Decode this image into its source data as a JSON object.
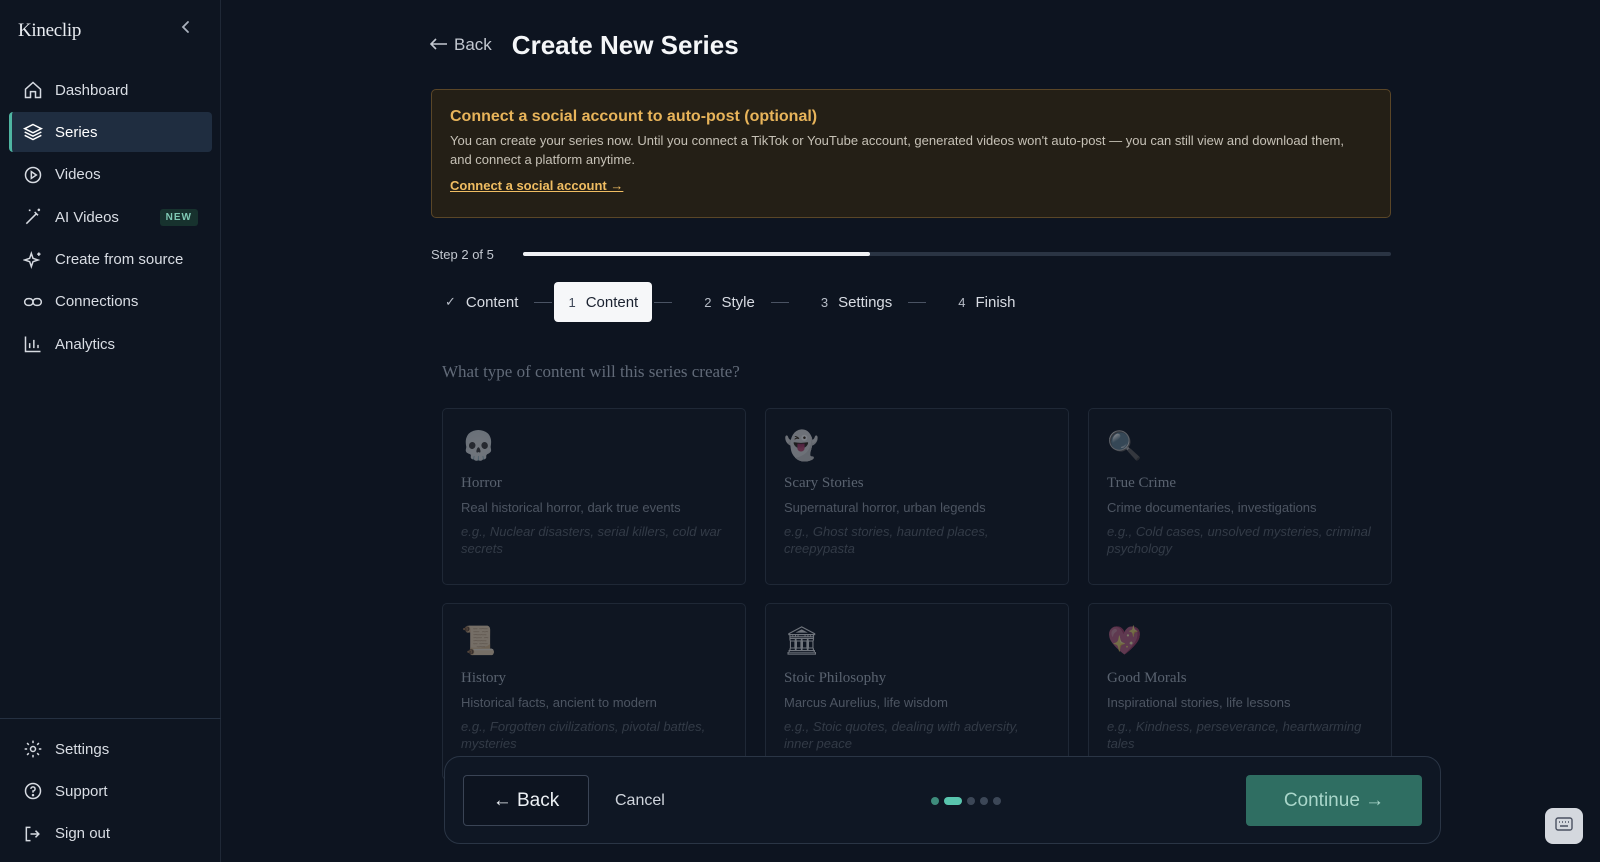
{
  "app": {
    "name": "Kineclip"
  },
  "sidebar": {
    "items": [
      {
        "label": "Dashboard",
        "icon": "home-icon"
      },
      {
        "label": "Series",
        "icon": "layers-icon",
        "active": true
      },
      {
        "label": "Videos",
        "icon": "play-circle-icon"
      },
      {
        "label": "AI Videos",
        "icon": "magic-wand-icon",
        "badge": "NEW"
      },
      {
        "label": "Create from source",
        "icon": "sparkles-icon"
      },
      {
        "label": "Connections",
        "icon": "link-icon"
      },
      {
        "label": "Analytics",
        "icon": "bar-chart-icon"
      }
    ],
    "bottom_items": [
      {
        "label": "Settings",
        "icon": "gear-icon"
      },
      {
        "label": "Support",
        "icon": "help-circle-icon"
      },
      {
        "label": "Sign out",
        "icon": "sign-out-icon"
      }
    ]
  },
  "header": {
    "back_label": "Back",
    "title": "Create New Series"
  },
  "notice": {
    "title": "Connect a social account to auto-post (optional)",
    "body": "You can create your series now. Until you connect a TikTok or YouTube account, generated videos won't auto-post — you can still view and download them, and connect a platform anytime.",
    "link": "Connect a social account →"
  },
  "progress": {
    "label": "Step 2 of 5",
    "fraction": 0.4
  },
  "stepper": {
    "steps": [
      {
        "num": "✓",
        "label": "Content"
      },
      {
        "num": "1",
        "label": "Content",
        "current": true
      },
      {
        "num": "2",
        "label": "Style"
      },
      {
        "num": "3",
        "label": "Settings"
      },
      {
        "num": "4",
        "label": "Finish"
      }
    ]
  },
  "question": "What type of content will this series create?",
  "cards": [
    {
      "emoji": "💀",
      "name": "Horror",
      "desc": "Real historical horror, dark true events",
      "example": "e.g., Nuclear disasters, serial killers, cold war secrets"
    },
    {
      "emoji": "👻",
      "name": "Scary Stories",
      "desc": "Supernatural horror, urban legends",
      "example": "e.g., Ghost stories, haunted places, creepypasta"
    },
    {
      "emoji": "🔍",
      "name": "True Crime",
      "desc": "Crime documentaries, investigations",
      "example": "e.g., Cold cases, unsolved mysteries, criminal psychology"
    },
    {
      "emoji": "📜",
      "name": "History",
      "desc": "Historical facts, ancient to modern",
      "example": "e.g., Forgotten civilizations, pivotal battles, mysteries"
    },
    {
      "emoji": "🏛",
      "name": "Stoic Philosophy",
      "desc": "Marcus Aurelius, life wisdom",
      "example": "e.g., Stoic quotes, dealing with adversity, inner peace"
    },
    {
      "emoji": "💖",
      "name": "Good Morals",
      "desc": "Inspirational stories, life lessons",
      "example": "e.g., Kindness, perseverance, heartwarming tales"
    }
  ],
  "footer": {
    "back_label": "← Back",
    "cancel_label": "Cancel",
    "continue_label": "Continue →",
    "dots": [
      "done",
      "active",
      "todo",
      "todo",
      "todo"
    ]
  }
}
